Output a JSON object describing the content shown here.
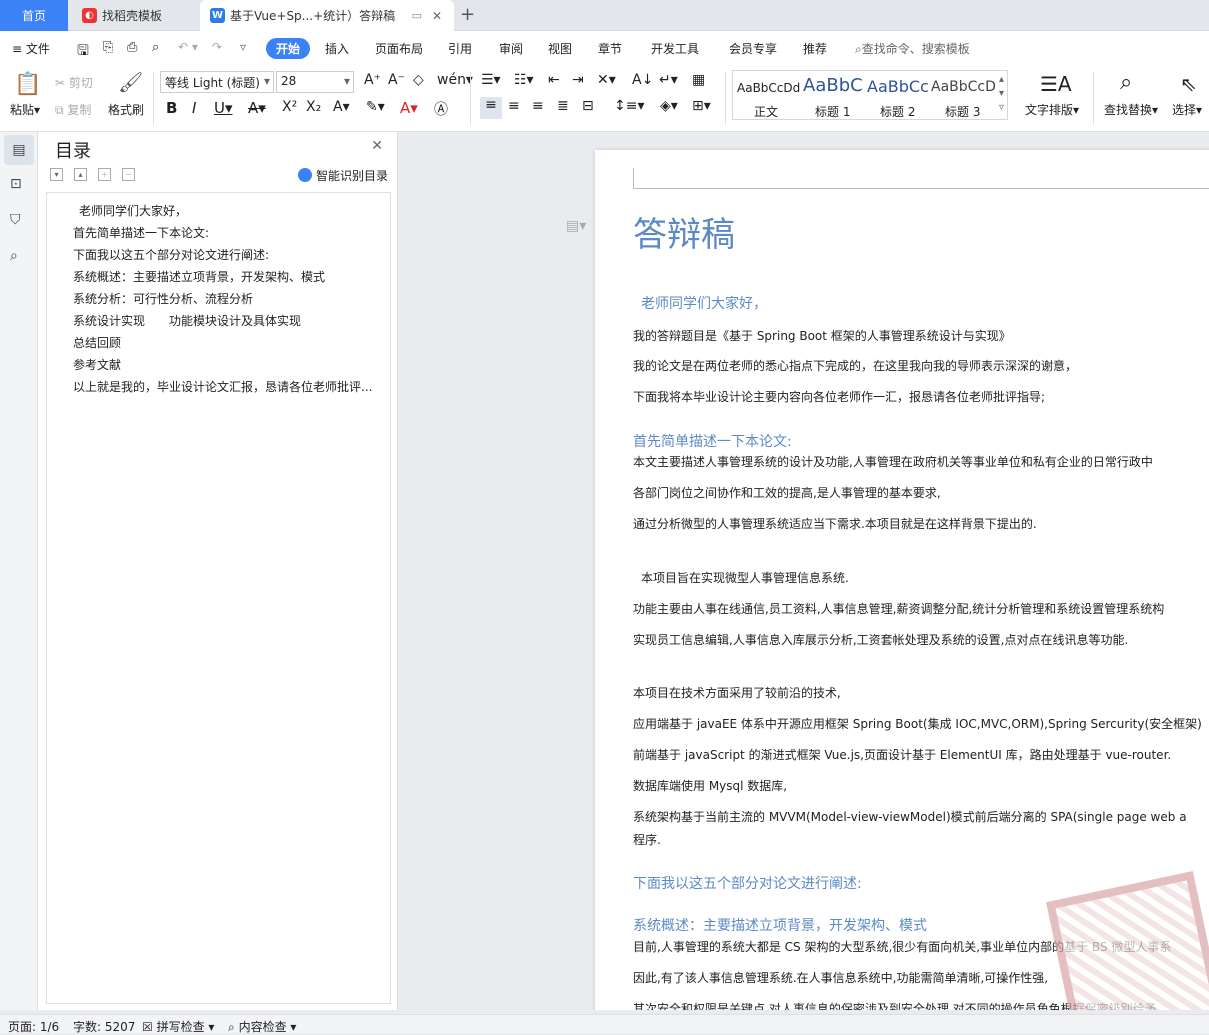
{
  "tabs": {
    "home": "首页",
    "template": "找稻壳模板",
    "doc_title": "基于Vue+Sp...+统计）答辩稿",
    "new_tab": "+"
  },
  "menu": {
    "file": "文件",
    "items": [
      "开始",
      "插入",
      "页面布局",
      "引用",
      "审阅",
      "视图",
      "章节",
      "开发工具",
      "会员专享",
      "推荐"
    ],
    "search": "查找命令、搜索模板"
  },
  "ribbon": {
    "paste": "粘贴",
    "cut": "剪切",
    "copy": "复制",
    "format_painter": "格式刷",
    "font_name": "等线 Light (标题)",
    "font_size": "28",
    "styles": [
      {
        "preview": "AaBbCcDd",
        "label": "正文"
      },
      {
        "preview": "AaBbC",
        "label": "标题 1"
      },
      {
        "preview": "AaBbCc",
        "label": "标题 2"
      },
      {
        "preview": "AaBbCcD",
        "label": "标题 3"
      }
    ],
    "text_layout": "文字排版",
    "find_replace": "查找替换",
    "select": "选择"
  },
  "toc": {
    "title": "目录",
    "smart": "智能识别目录",
    "items": [
      "老师同学们大家好，",
      "首先简单描述一下本论文:",
      "下面我以这五个部分对论文进行阐述:",
      "系统概述：主要描述立项背景，开发架构、模式",
      "系统分析：可行性分析、流程分析",
      "系统设计实现　　功能模块设计及具体实现",
      "总结回顾",
      "参考文献",
      "以上就是我的，毕业设计论文汇报，恳请各位老师批评..."
    ]
  },
  "document": {
    "title": "答辩稿",
    "lines": [
      {
        "cls": "h2",
        "text": "老师同学们大家好，"
      },
      {
        "cls": "",
        "text": "我的答辩题目是《基于 Spring Boot 框架的人事管理系统设计与实现》"
      },
      {
        "cls": "",
        "text": "我的论文是在两位老师的悉心指点下完成的，在这里我向我的导师表示深深的谢意，"
      },
      {
        "cls": "",
        "text": "下面我将本毕业设计论主要内容向各位老师作一汇，报恳请各位老师批评指导;"
      },
      {
        "cls": "h2",
        "text": "首先简单描述一下本论文:"
      },
      {
        "cls": "",
        "text": "本文主要描述人事管理系统的设计及功能,人事管理在政府机关等事业单位和私有企业的日常行政中"
      },
      {
        "cls": "",
        "text": "各部门岗位之间协作和工效的提高,是人事管理的基本要求,"
      },
      {
        "cls": "",
        "text": "通过分析微型的人事管理系统适应当下需求.本项目就是在这样背景下提出的."
      },
      {
        "cls": "",
        "text": "本项目旨在实现微型人事管理信息系统."
      },
      {
        "cls": "",
        "text": "功能主要由人事在线通信,员工资料,人事信息管理,薪资调整分配,统计分析管理和系统设置管理系统构"
      },
      {
        "cls": "",
        "text": "实现员工信息编辑,人事信息入库展示分析,工资套帐处理及系统的设置,点对点在线讯息等功能."
      },
      {
        "cls": "",
        "text": "本项目在技术方面采用了较前沿的技术,"
      },
      {
        "cls": "",
        "text": "应用端基于 javaEE 体系中开源应用框架 Spring Boot(集成 IOC,MVC,ORM),Spring Sercurity(安全框架)"
      },
      {
        "cls": "",
        "text": "前端基于 javaScript 的渐进式框架 Vue.js,页面设计基于 ElementUI 库，路由处理基于 vue-router."
      },
      {
        "cls": "",
        "text": "数据库端使用 Mysql 数据库,"
      },
      {
        "cls": "",
        "text": "系统架构基于当前主流的 MVVM(Model-view-viewModel)模式前后端分离的 SPA(single page web a"
      },
      {
        "cls": "",
        "text": "程序."
      },
      {
        "cls": "h2",
        "text": "下面我以这五个部分对论文进行阐述:"
      },
      {
        "cls": "h2",
        "text": "系统概述：主要描述立项背景，开发架构、模式"
      },
      {
        "cls": "",
        "text": "目前,人事管理的系统大都是 CS 架构的大型系统,很少有面向机关,事业单位内部的基于 BS 微型人事系"
      },
      {
        "cls": "",
        "text": "因此,有了该人事信息管理系统.在人事信息系统中,功能需简单清晰,可操作性强,"
      },
      {
        "cls": "",
        "text": "其次安全和权限是关键点,对人事信息的保密涉及到安全处理,对不同的操作员角色根据保密级别给予"
      }
    ]
  },
  "status": {
    "page": "页面: 1/6",
    "words": "字数: 5207",
    "spell": "拼写检查",
    "content": "内容检查"
  }
}
